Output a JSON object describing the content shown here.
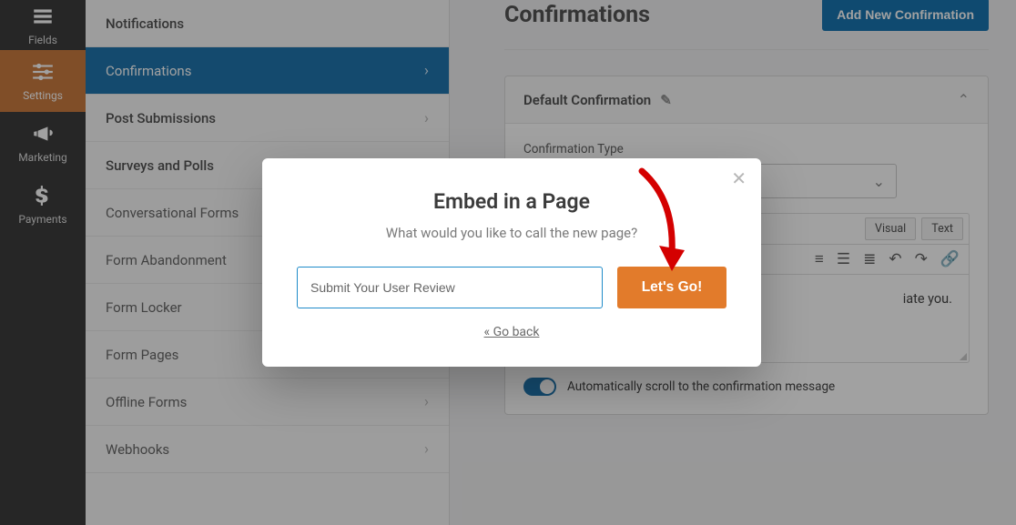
{
  "rail": {
    "items": [
      {
        "label": "Fields",
        "icon": "list-icon"
      },
      {
        "label": "Settings",
        "icon": "sliders-icon",
        "active": true
      },
      {
        "label": "Marketing",
        "icon": "bullhorn-icon"
      },
      {
        "label": "Payments",
        "icon": "dollar-icon"
      }
    ]
  },
  "sidebar": {
    "items": [
      {
        "label": "Notifications"
      },
      {
        "label": "Confirmations",
        "active": true
      },
      {
        "label": "Post Submissions"
      },
      {
        "label": "Surveys and Polls"
      },
      {
        "label": "Conversational Forms"
      },
      {
        "label": "Form Abandonment"
      },
      {
        "label": "Form Locker"
      },
      {
        "label": "Form Pages"
      },
      {
        "label": "Offline Forms"
      },
      {
        "label": "Webhooks"
      }
    ]
  },
  "page": {
    "title": "Confirmations",
    "add_button": "Add New Confirmation"
  },
  "panel": {
    "title": "Default Confirmation",
    "type_label": "Confirmation Type",
    "selected_type": "",
    "tabs": {
      "visual": "Visual",
      "text": "Text"
    },
    "message_preview": "iate you.",
    "scroll_label": "Automatically scroll to the confirmation message"
  },
  "modal": {
    "title": "Embed in a Page",
    "subtitle": "What would you like to call the new page?",
    "input_value": "Submit Your User Review",
    "go_label": "Let's Go!",
    "back_label": "« Go back"
  }
}
